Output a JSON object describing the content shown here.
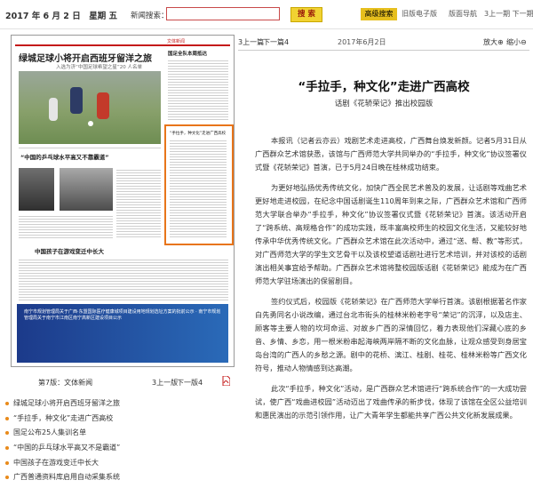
{
  "topbar": {
    "date": "2017 年 6 月 2 日　星期 五",
    "search_label": "新闻搜索：",
    "search_value": "",
    "search_button": "搜 索",
    "advanced_search": "高级搜索",
    "old_edition": "旧版电子版",
    "layout_nav": "版面导航",
    "issue_nav": "3上一期 下一期"
  },
  "thumbnail": {
    "section": "文体新闻",
    "headline": "绿城足球小将开启西班牙留洋之旅",
    "subhead": "入选为济“中国足球希望之星”20 人名单",
    "sidebar_title": "国足全队本周抵达",
    "story2_title": "“中国的乒乓球水平高又不靠霸道”",
    "story3_title": "中国孩子在游戏变迁中长大",
    "highlight_title": "“手拉手，种文化”走进广西高校",
    "ad_text": "南宁市规划管理局关于广西·东盟国际医疗健康城项目建设用地规划选址方案的批前公示 · 南宁市规划管理局关于南宁市江南区南宁高新区建设项目公示",
    "ad_color": "#1c3a8a"
  },
  "page_nav": {
    "label": "第7版：文体新闻",
    "prev": "3上一版",
    "next": "下一版4",
    "pdf_icon": "pdf-icon"
  },
  "articles": [
    "绿城足球小将开启西班牙留洋之旅",
    "“手拉手，种文化”走进广西高校",
    "国足公布25人集训名单",
    "“中国的乒乓球水平高又不是霸道”",
    "中国孩子在游戏变迁中长大",
    "广西普通资料库启用自动采集系统"
  ],
  "article_bullet_color": "#e98a1a",
  "content": {
    "prev": "3上一篇",
    "next": "下一篇4",
    "date": "2017年6月2日",
    "zoom_in": "放大⊕",
    "zoom_out": "缩小⊖",
    "title": "“手拉手，种文化”走进广西高校",
    "subtitle": "话剧《花轿荣记》推出校园版",
    "paragraphs": [
      "本报讯（记者云亦云）戏剧艺术走进高校，广西舞台焕发新颜。记者5月31日从广西群众艺术馆获悉，该馆与广西师范大学共同举办的“手拉手，种文化”协议签署仪式暨《花轿荣记》首演，已于5月24日晚在桂林成功结束。",
      "为更好地弘扬优秀传统文化，加快广西全民艺术普及的发展，让话剧等戏曲艺术更好地走进校园，在纪念中国话剧诞生110周年到来之际，广西群众艺术馆和广西师范大学联合举办“手拉手，种文化”协议签署仪式暨《花轿荣记》首演。该活动开启了“跨系统、高规格合作”的成功实践，既丰富高校师生的校园文化生活，又能较好地传承中华优秀传统文化。广西群众艺术馆在此次活动中，通过“送、帮、教”等形式，对广西师范大学的学生文艺骨干以及该校望道话剧社进行艺术培训，并对该校的话剧演出相关事宜给予帮助。广西群众艺术馆将整校园版话剧《花轿荣记》能成为在广西师范大学驻场演出的保留剧目。",
      "签约仪式后，校园版《花轿荣记》在广西师范大学举行首演。该剧根据著名作家白先勇同名小说改编，通过台北市街头的桂林米粉老字号“荣记”的沉浮，以及店主、顾客等主要人物的坎坷命运、对故乡广西的深情回忆，着力表现他们深藏心底的乡音、乡情、乡恋，用一根米粉串起海峡两岸隔不断的文化血脉，让观众感受到身居宝岛台湾的广西人的乡愁之源。剧中的花桥、漓江、桂剧、桂花、桂林米粉等广西文化符号，推动人物情感到达高潮。",
      "此次“手拉手，种文化”活动，是广西群众艺术馆进行“跨系统合作”的一大成功尝试，使广西“戏曲进校园”活动迈出了戏曲传承的新步伐，体现了该馆在全区公益培训和惠民演出的示范引领作用，让广大青年学生都能共享广西公共文化新发展成果。"
    ]
  }
}
